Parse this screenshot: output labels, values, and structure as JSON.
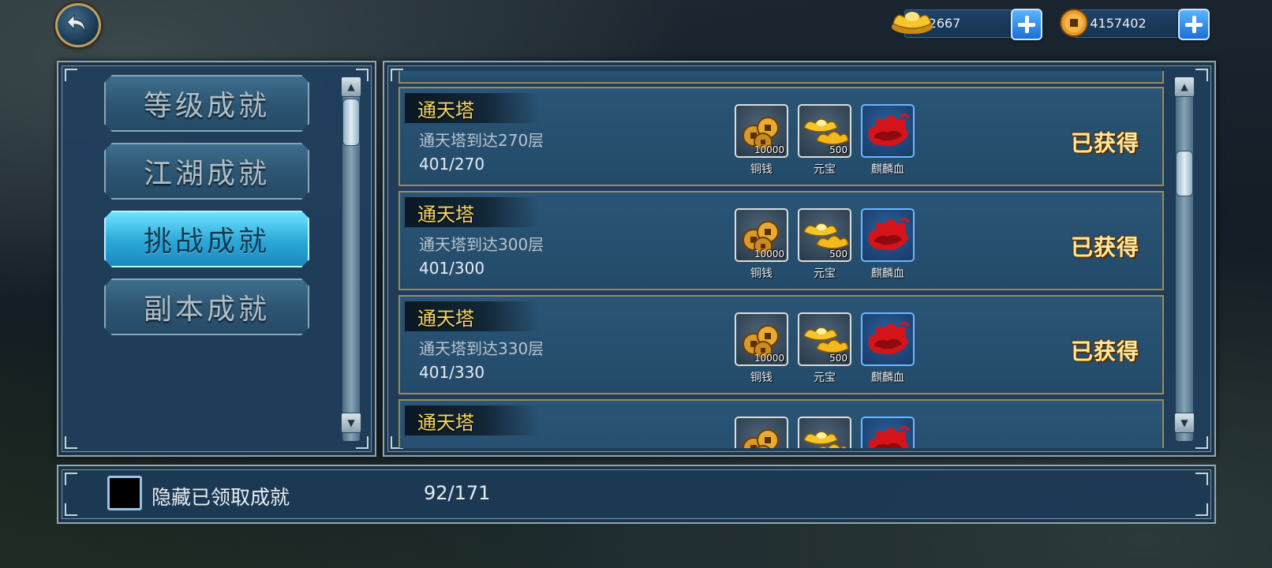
{
  "header": {
    "back_icon": "back-arrow-icon",
    "ingot": {
      "icon": "gold-ingot-icon",
      "value": "2667"
    },
    "copper": {
      "icon": "copper-coin-icon",
      "value": "4157402"
    }
  },
  "sidebar": {
    "items": [
      {
        "label": "等级成就",
        "active": false
      },
      {
        "label": "江湖成就",
        "active": false
      },
      {
        "label": "挑战成就",
        "active": true
      },
      {
        "label": "副本成就",
        "active": false
      }
    ]
  },
  "achievements": [
    {
      "title": "通天塔",
      "desc": "通天塔到达270层",
      "progress": "401/270",
      "status": "已获得",
      "rewards": [
        {
          "icon": "copper-coins-icon",
          "qty": "10000",
          "label": "铜钱"
        },
        {
          "icon": "gold-ingot-icon",
          "qty": "500",
          "label": "元宝"
        },
        {
          "icon": "qilin-blood-icon",
          "qty": "",
          "label": "麒麟血"
        }
      ]
    },
    {
      "title": "通天塔",
      "desc": "通天塔到达300层",
      "progress": "401/300",
      "status": "已获得",
      "rewards": [
        {
          "icon": "copper-coins-icon",
          "qty": "10000",
          "label": "铜钱"
        },
        {
          "icon": "gold-ingot-icon",
          "qty": "500",
          "label": "元宝"
        },
        {
          "icon": "qilin-blood-icon",
          "qty": "",
          "label": "麒麟血"
        }
      ]
    },
    {
      "title": "通天塔",
      "desc": "通天塔到达330层",
      "progress": "401/330",
      "status": "已获得",
      "rewards": [
        {
          "icon": "copper-coins-icon",
          "qty": "10000",
          "label": "铜钱"
        },
        {
          "icon": "gold-ingot-icon",
          "qty": "500",
          "label": "元宝"
        },
        {
          "icon": "qilin-blood-icon",
          "qty": "",
          "label": "麒麟血"
        }
      ]
    },
    {
      "title": "通天塔",
      "desc": "",
      "progress": "",
      "status": "",
      "rewards": [
        {
          "icon": "copper-coins-icon",
          "qty": "",
          "label": ""
        },
        {
          "icon": "gold-ingot-icon",
          "qty": "",
          "label": ""
        },
        {
          "icon": "qilin-blood-icon",
          "qty": "",
          "label": ""
        }
      ]
    }
  ],
  "footer": {
    "hide_label": "隐藏已领取成就",
    "count": "92/171"
  },
  "colors": {
    "title_gold": "#f5d562",
    "active_tab": "#2aa7d8",
    "panel_blue": "#203f5c",
    "row_border": "#9c8a56"
  }
}
